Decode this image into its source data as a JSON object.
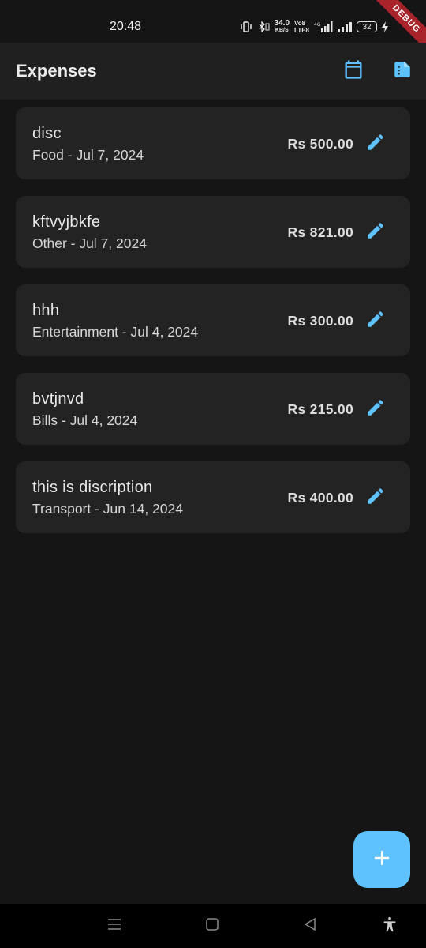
{
  "status_bar": {
    "time": "20:48",
    "net_speed_value": "34.0",
    "net_speed_unit": "KB/S",
    "volte_top": "Vo8",
    "volte_bottom": "LTE8",
    "network": "4G",
    "battery": "32",
    "debug_label": "DEBUG"
  },
  "app_bar": {
    "title": "Expenses",
    "icons": [
      "calendar-icon",
      "note-icon"
    ]
  },
  "accent_color": "#5ec2ff",
  "expenses": [
    {
      "description": "disc",
      "subtitle": "Food - Jul 7, 2024",
      "amount": "Rs 500.00"
    },
    {
      "description": "kftvyjbkfe",
      "subtitle": "Other - Jul 7, 2024",
      "amount": "Rs 821.00"
    },
    {
      "description": "hhh",
      "subtitle": "Entertainment - Jul 4, 2024",
      "amount": "Rs 300.00"
    },
    {
      "description": "bvtjnvd",
      "subtitle": "Bills - Jul 4, 2024",
      "amount": "Rs 215.00"
    },
    {
      "description": "this is discription",
      "subtitle": "Transport - Jun 14, 2024",
      "amount": "Rs 400.00"
    }
  ],
  "fab": {
    "icon": "plus-icon"
  },
  "nav_bar": {
    "icons": [
      "menu-icon",
      "home-icon",
      "back-icon",
      "accessibility-icon"
    ]
  }
}
